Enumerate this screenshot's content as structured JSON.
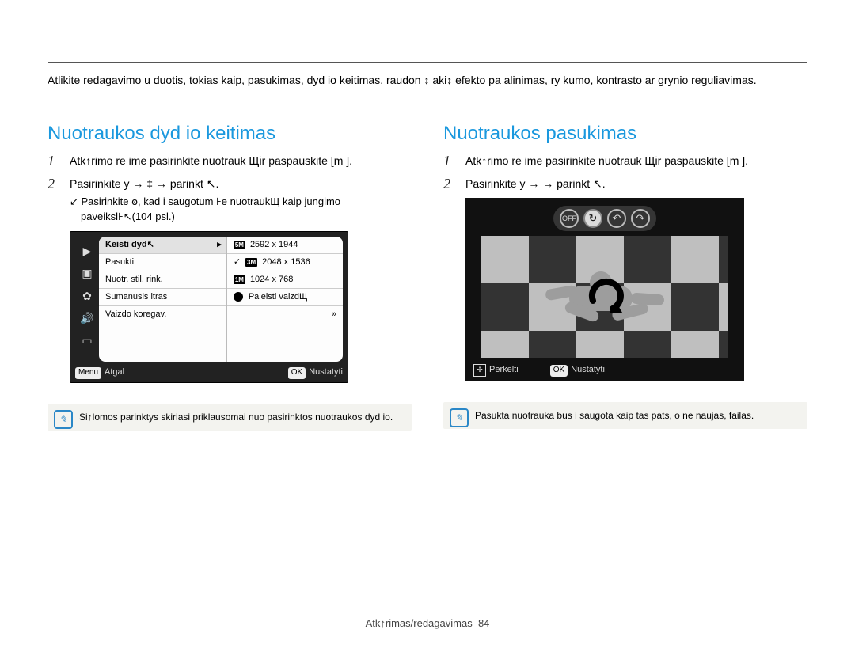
{
  "intro": "Atlikite redagavimo u duotis, tokias kaip, pasukimas, dyd io keitimas, raudon ↕ aki↕ efekto pa alinimas, ry kumo, kontrasto ar grynio reguliavimas.",
  "left": {
    "heading": "Nuotraukos dyd io keitimas",
    "step1": "Atk↑rimo re ime pasirinkite nuotrauk Щіr paspauskite [m       ].",
    "step2": "Pasirinkite y      →  ‡ → parinkt ↖.",
    "step2_sub": "↙  Pasirinkite ꙩ, kad i saugotum ⊦e nuotraukЩ kaip  ϳungimo paveiksl⊦↖(104 psl.)",
    "menu": {
      "left_items": [
        "Keisti dyd↖",
        "Pasukti",
        "Nuotr. stil. rink.",
        "Sumanusis  ltras",
        "Vaizdo koregav."
      ],
      "selected_index": 0,
      "right": [
        {
          "icon": "5M",
          "label": "2592 x 1944"
        },
        {
          "icon": "3M",
          "label": "2048 x 1536",
          "checked": true
        },
        {
          "icon": "1M",
          "label": "1024 x 768"
        },
        {
          "startup": true,
          "label": "Paleisti vaizdЩ"
        },
        {
          "label": "",
          "more": true
        }
      ],
      "footer_left_btn": "Menu",
      "footer_left": "Atgal",
      "footer_right_btn": "OK",
      "footer_right": "Nustatyti"
    },
    "note": "Si↑lomos parinktys skiriasi priklausomai nuo pasirinktos nuotraukos dyd io."
  },
  "right": {
    "heading": "Nuotraukos pasukimas",
    "step1": "Atk↑rimo re ime pasirinkite nuotrauk Щіr paspauskite [m       ].",
    "step2": "Pasirinkite y      →            → parinkt ↖.",
    "preview": {
      "toolbar": [
        "off",
        "rotate",
        "undo",
        "redo"
      ],
      "footer_move": "Perkelti",
      "footer_ok_btn": "OK",
      "footer_ok": "Nustatyti"
    },
    "note": "Pasukta nuotrauka bus i saugota kaip tas pats, o ne naujas, failas."
  },
  "footer": {
    "section": "Atk↑rimas/redagavimas",
    "page": "84"
  }
}
